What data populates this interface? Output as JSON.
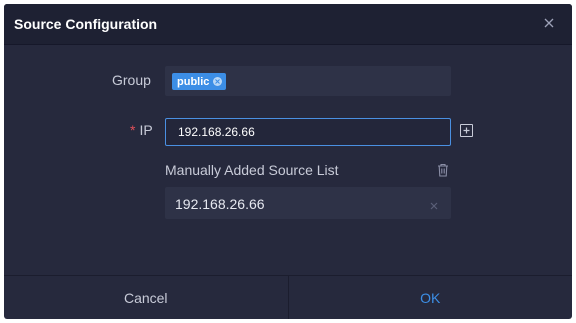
{
  "dialog": {
    "title": "Source Configuration",
    "close_icon": "close-icon"
  },
  "form": {
    "group_label": "Group",
    "group_tags": [
      {
        "label": "public",
        "color": "#3c8ee6"
      }
    ],
    "ip_required_mark": "*",
    "ip_label": "IP",
    "ip_value": "192.168.26.66",
    "add_icon": "plus-square-icon"
  },
  "source_list": {
    "title": "Manually Added Source List",
    "delete_icon": "trash-icon",
    "items": [
      {
        "value": "192.168.26.66"
      }
    ]
  },
  "footer": {
    "cancel_label": "Cancel",
    "ok_label": "OK"
  },
  "colors": {
    "accent": "#3c8ee6",
    "required": "#e2505a",
    "background": "#26293d"
  }
}
